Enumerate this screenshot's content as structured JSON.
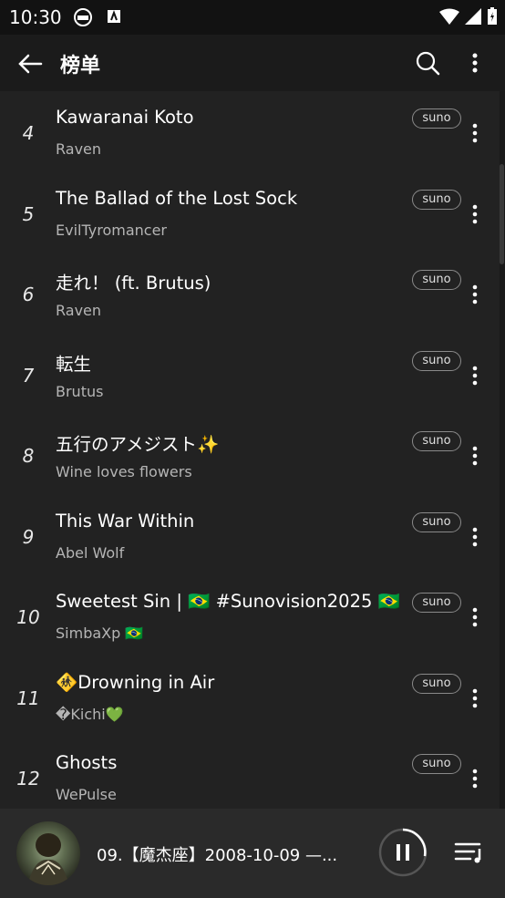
{
  "status_bar": {
    "time": "10:30"
  },
  "header": {
    "title": "榜单"
  },
  "tracks": [
    {
      "rank": "4",
      "title": "Kawaranai Koto",
      "artist": "Raven",
      "badge": "suno"
    },
    {
      "rank": "5",
      "title": "The Ballad of the Lost Sock",
      "artist": "EvilTyromancer",
      "badge": "suno"
    },
    {
      "rank": "6",
      "title": "走れ！ (ft. Brutus)",
      "artist": "Raven",
      "badge": "suno"
    },
    {
      "rank": "7",
      "title": "転生",
      "artist": "Brutus",
      "badge": "suno"
    },
    {
      "rank": "8",
      "title": "五行のアメジスト✨",
      "artist": "Wine loves flowers",
      "badge": "suno"
    },
    {
      "rank": "9",
      "title": "This War Within",
      "artist": "Abel Wolf",
      "badge": "suno"
    },
    {
      "rank": "10",
      "title": "Sweetest Sin | 🇧🇷 #Sunovision2025 🇧🇷",
      "artist": "SimbaXp 🇧🇷",
      "badge": "suno"
    },
    {
      "rank": "11",
      "title": "🚸Drowning in Air",
      "artist": "�Kichi💚",
      "badge": "suno"
    },
    {
      "rank": "12",
      "title": "Ghosts",
      "artist": "WePulse",
      "badge": "suno"
    }
  ],
  "player": {
    "now_playing": "09.【魔杰座】2008-10-09 —..."
  },
  "colors": {
    "background": "#222222",
    "header": "#1b1b1b",
    "player": "#2a2a2a",
    "muted_text": "#b5b5b5"
  },
  "icons": [
    "back-arrow-icon",
    "search-icon",
    "more-vert-icon",
    "pause-icon",
    "playlist-icon"
  ]
}
